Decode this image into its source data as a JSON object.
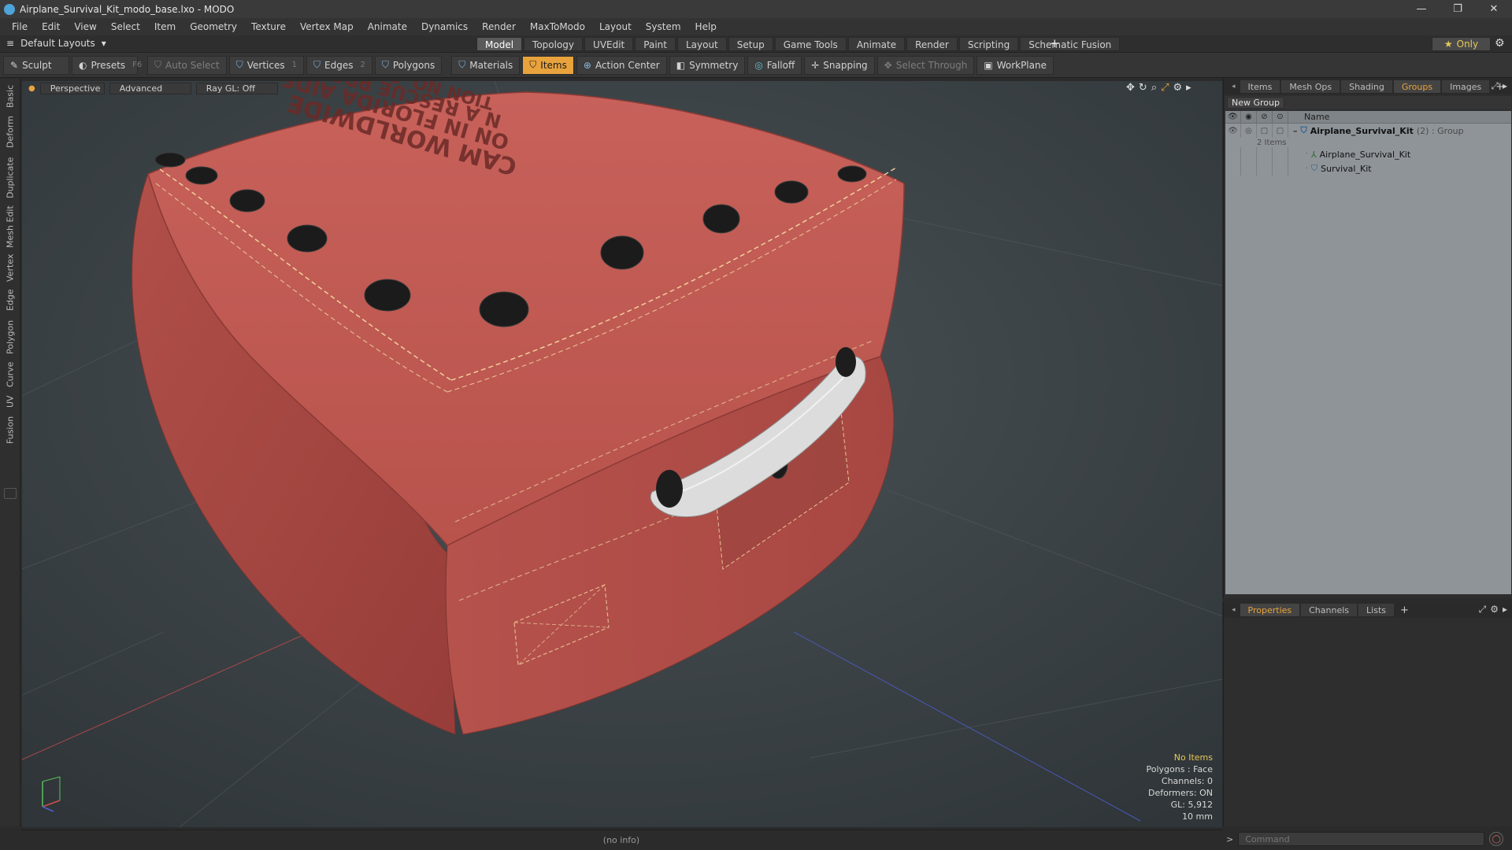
{
  "window": {
    "title": "Airplane_Survival_Kit_modo_base.lxo - MODO"
  },
  "menu": [
    "File",
    "Edit",
    "View",
    "Select",
    "Item",
    "Geometry",
    "Texture",
    "Vertex Map",
    "Animate",
    "Dynamics",
    "Render",
    "MaxToModo",
    "Layout",
    "System",
    "Help"
  ],
  "layout": {
    "selector": "Default Layouts",
    "tabs": [
      "Model",
      "Topology",
      "UVEdit",
      "Paint",
      "Layout",
      "Setup",
      "Game Tools",
      "Animate",
      "Render",
      "Scripting",
      "Schematic Fusion"
    ],
    "active_tab": "Model",
    "only_label": "Only"
  },
  "toolbar": {
    "sculpt": "Sculpt",
    "presets": "Presets",
    "presets_hotkey": "F6",
    "auto_select": "Auto Select",
    "vertices": "Vertices",
    "vertices_hotkey": "1",
    "edges": "Edges",
    "edges_hotkey": "2",
    "polygons": "Polygons",
    "materials": "Materials",
    "items": "Items",
    "action_center": "Action Center",
    "symmetry": "Symmetry",
    "falloff": "Falloff",
    "snapping": "Snapping",
    "select_through": "Select Through",
    "workplane": "WorkPlane"
  },
  "left_tabs": [
    "Basic",
    "Deform",
    "Duplicate",
    "Mesh Edit",
    "Vertex",
    "Edge",
    "Polygon",
    "Curve",
    "UV",
    "Fusion"
  ],
  "viewport": {
    "view": "Perspective",
    "shading": "Advanced",
    "raygl": "Ray GL: Off",
    "info": {
      "no_items": "No Items",
      "polygons": "Polygons : Face",
      "channels": "Channels: 0",
      "deformers": "Deformers: ON",
      "gl": "GL: 5,912",
      "scale": "10 mm"
    },
    "bag_text": [
      "CAM WORLDWIDE",
      "ON IN FLORIDA AIDS",
      "N A RESCUE PRODUCTS",
      "TION NO. REF0701992"
    ]
  },
  "status": {
    "info": "(no info)"
  },
  "right_panel": {
    "tabs": [
      "Items",
      "Mesh Ops",
      "Shading",
      "Groups",
      "Images"
    ],
    "active_tab": "Groups",
    "new_group": "New Group",
    "column_name": "Name",
    "group": {
      "name": "Airplane_Survival_Kit",
      "suffix": "(2) : Group",
      "count": "2 Items"
    },
    "children": [
      "Airplane_Survival_Kit",
      "Survival_Kit"
    ]
  },
  "props_panel": {
    "tabs": [
      "Properties",
      "Channels",
      "Lists"
    ],
    "active_tab": "Properties"
  },
  "command": {
    "placeholder": "Command"
  },
  "colors": {
    "accent": "#e8a33d",
    "viewport_bg": "#3c4245",
    "bag": "#b4504a"
  }
}
